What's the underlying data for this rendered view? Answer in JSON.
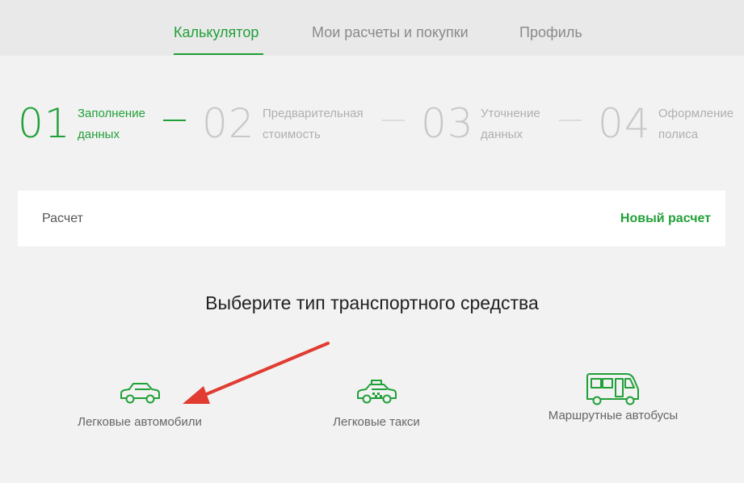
{
  "nav": {
    "tabs": [
      {
        "label": "Калькулятор",
        "active": true
      },
      {
        "label": "Мои расчеты и покупки",
        "active": false
      },
      {
        "label": "Профиль",
        "active": false
      }
    ]
  },
  "steps": [
    {
      "number": "01",
      "line1": "Заполнение",
      "line2": "данных",
      "active": true
    },
    {
      "number": "02",
      "line1": "Предварительная",
      "line2": "стоимость",
      "active": false
    },
    {
      "number": "03",
      "line1": "Уточнение",
      "line2": "данных",
      "active": false
    },
    {
      "number": "04",
      "line1": "Оформление",
      "line2": "полиса",
      "active": false
    }
  ],
  "card": {
    "title": "Расчет",
    "action": "Новый расчет"
  },
  "heading": "Выберите тип транспортного средства",
  "vehicles": [
    {
      "label": "Легковые автомобили",
      "icon": "car-icon"
    },
    {
      "label": "Легковые такси",
      "icon": "taxi-icon"
    },
    {
      "label": "Маршрутные автобусы",
      "icon": "bus-icon"
    }
  ],
  "colors": {
    "accent": "#21a038",
    "inactive": "#c8c8c8",
    "annotation_arrow": "#e03c31"
  }
}
